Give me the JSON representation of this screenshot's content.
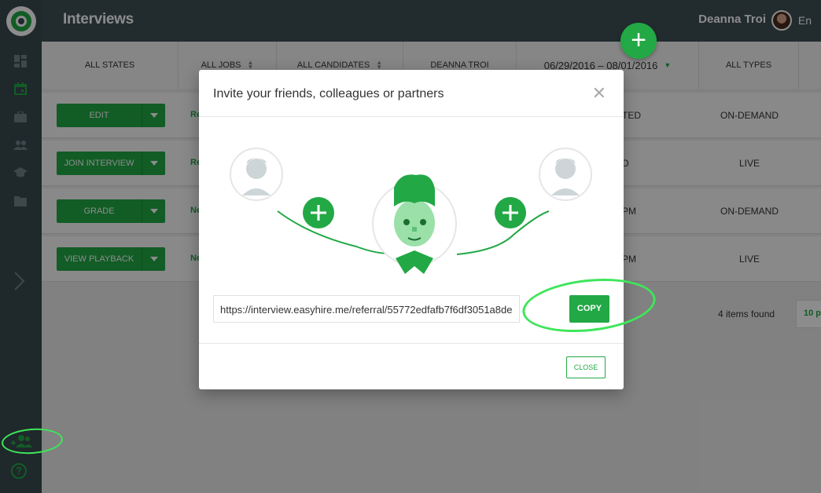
{
  "header": {
    "title": "Interviews",
    "user_name": "Deanna Troi",
    "language": "En"
  },
  "filters": [
    {
      "label": "ALL STATES"
    },
    {
      "label": "ALL JOBS"
    },
    {
      "label": "ALL CANDIDATES"
    },
    {
      "label": "DEANNA TROI"
    },
    {
      "label": "06/29/2016  –  08/01/2016"
    },
    {
      "label": "ALL TYPES"
    }
  ],
  "rows": [
    {
      "action": "EDIT",
      "status": "Re",
      "time": "TED",
      "type": "ON-DEMAND"
    },
    {
      "action": "JOIN INTERVIEW",
      "status": "Re",
      "time": "D",
      "type": "LIVE"
    },
    {
      "action": "GRADE",
      "status": "Ne",
      "time": "PM",
      "type": "ON-DEMAND"
    },
    {
      "action": "VIEW PLAYBACK",
      "status": "Ne",
      "time": "PM",
      "type": "LIVE"
    }
  ],
  "footer": {
    "items_found": "4 items found",
    "per_page": "10 p"
  },
  "modal": {
    "title": "Invite your friends, colleagues or partners",
    "referral_link": "https://interview.easyhire.me/referral/55772edfafb7f6df3051a8de",
    "copy_label": "COPY",
    "close_label": "CLOSE"
  },
  "colors": {
    "accent": "#22a845",
    "sidebar": "#3a4a4f",
    "header": "#3f5156",
    "highlight": "#3ee65a"
  },
  "icons": [
    "dashboard-icon",
    "calendar-icon",
    "briefcase-icon",
    "people-icon",
    "graduation-cap-icon",
    "folder-icon",
    "chevron-right-icon",
    "invite-friends-icon",
    "help-icon"
  ]
}
